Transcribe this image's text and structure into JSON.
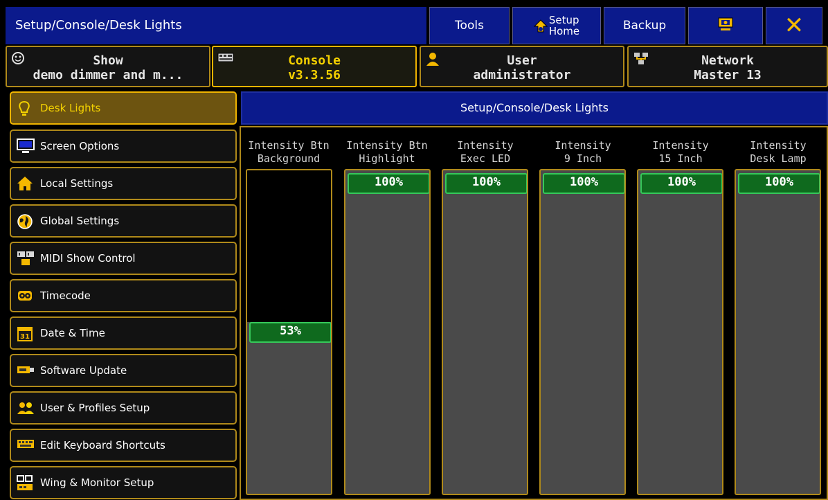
{
  "titlebar": {
    "title": "Setup/Console/Desk Lights",
    "tools_label": "Tools",
    "setup_home_line1": "Setup",
    "setup_home_line2": "Home",
    "backup_label": "Backup",
    "accent": "#f4b800",
    "bar_color": "#0b1a8c"
  },
  "tabs": [
    {
      "label": "Show",
      "value": "demo dimmer and m...",
      "icon": "show-icon"
    },
    {
      "label": "Console",
      "value": "v3.3.56",
      "icon": "console-icon",
      "active": true
    },
    {
      "label": "User",
      "value": "administrator",
      "icon": "user-icon"
    },
    {
      "label": "Network",
      "value": "Master 13",
      "icon": "network-icon"
    }
  ],
  "sidebar": {
    "items": [
      {
        "label": "Desk Lights",
        "icon": "bulb-icon",
        "active": true
      },
      {
        "label": "Screen Options",
        "icon": "monitor-icon"
      },
      {
        "label": "Local Settings",
        "icon": "home-icon"
      },
      {
        "label": "Global Settings",
        "icon": "globe-icon"
      },
      {
        "label": "MIDI Show Control",
        "icon": "midi-icon"
      },
      {
        "label": "Timecode",
        "icon": "timecode-icon"
      },
      {
        "label": "Date & Time",
        "icon": "calendar-icon"
      },
      {
        "label": "Software Update",
        "icon": "usb-icon"
      },
      {
        "label": "User & Profiles Setup",
        "icon": "users-icon"
      },
      {
        "label": "Edit Keyboard Shortcuts",
        "icon": "keyboard-icon"
      },
      {
        "label": "Wing & Monitor Setup",
        "icon": "wing-icon"
      }
    ]
  },
  "content": {
    "title": "Setup/Console/Desk Lights",
    "faders": [
      {
        "label1": "Intensity Btn",
        "label2": "Background",
        "value_text": "53%",
        "value": 53
      },
      {
        "label1": "Intensity Btn",
        "label2": "Highlight",
        "value_text": "100%",
        "value": 100
      },
      {
        "label1": "Intensity",
        "label2": "Exec LED",
        "value_text": "100%",
        "value": 100
      },
      {
        "label1": "Intensity",
        "label2": "9 Inch",
        "value_text": "100%",
        "value": 100
      },
      {
        "label1": "Intensity",
        "label2": "15 Inch",
        "value_text": "100%",
        "value": 100
      },
      {
        "label1": "Intensity",
        "label2": "Desk Lamp",
        "value_text": "100%",
        "value": 100
      }
    ]
  }
}
